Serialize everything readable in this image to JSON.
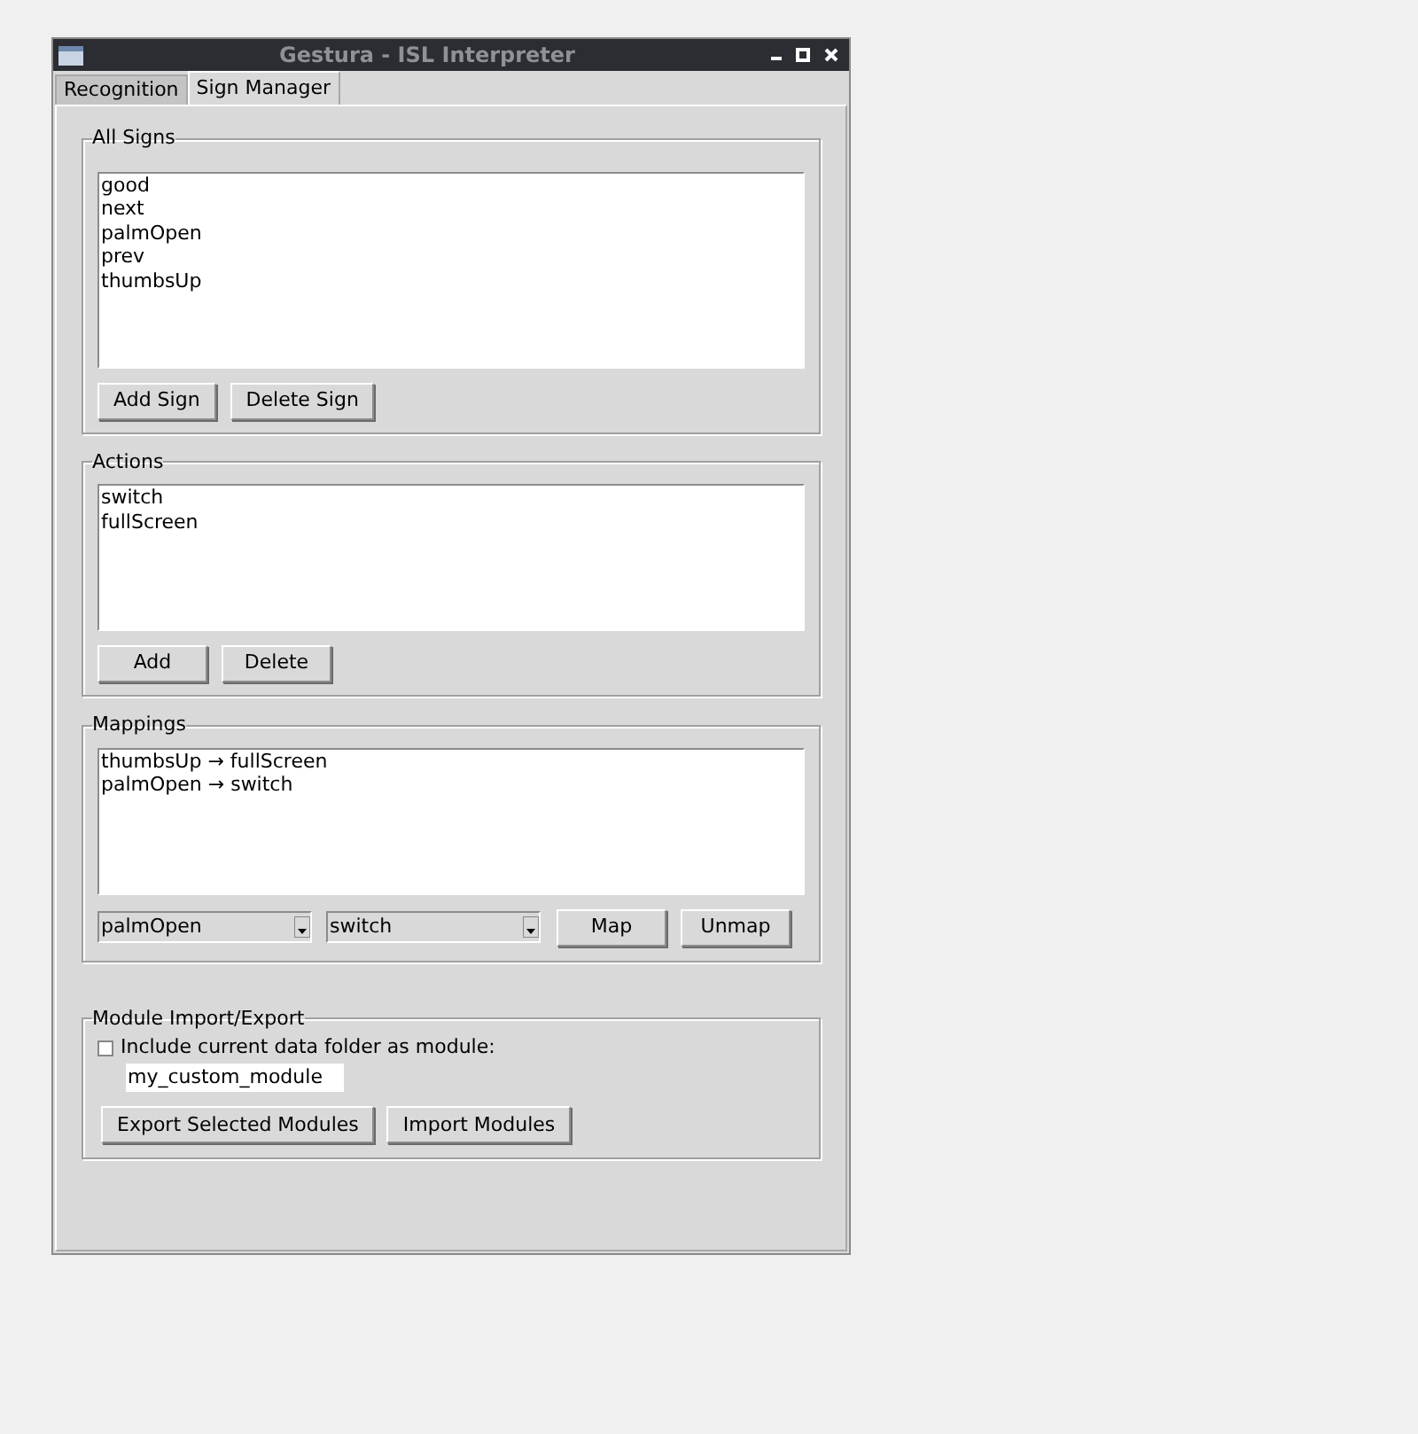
{
  "window": {
    "title": "Gestura - ISL Interpreter"
  },
  "tabs": [
    {
      "label": "Recognition",
      "selected": false
    },
    {
      "label": "Sign Manager",
      "selected": true
    }
  ],
  "all_signs": {
    "title": "All Signs",
    "items": [
      "good",
      "next",
      "palmOpen",
      "prev",
      "thumbsUp"
    ],
    "buttons": [
      "Add Sign",
      "Delete Sign"
    ]
  },
  "actions": {
    "title": "Actions",
    "items": [
      "switch",
      "fullScreen"
    ],
    "buttons": [
      "Add",
      "Delete"
    ]
  },
  "mappings": {
    "title": "Mappings",
    "items": [
      "thumbsUp → fullScreen",
      "palmOpen → switch"
    ],
    "sign_select": "palmOpen",
    "action_select": "switch",
    "buttons": [
      "Map",
      "Unmap"
    ]
  },
  "module": {
    "title": "Module Import/Export",
    "checkbox": {
      "label": "Include current data folder as module:",
      "checked": false
    },
    "name_field": "my_custom_module",
    "buttons": [
      "Export Selected Modules",
      "Import Modules"
    ]
  }
}
